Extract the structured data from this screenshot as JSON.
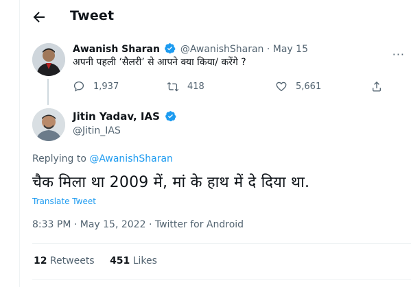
{
  "header": {
    "title": "Tweet"
  },
  "original_tweet": {
    "name": "Awanish Sharan",
    "handle": "@AwanishSharan",
    "separator": " · ",
    "date": "May 15",
    "text": "अपनी पहली ‘सैलरी’ से आपने क्या किया/ करेंगे ?",
    "replies": "1,937",
    "retweets": "418",
    "likes": "5,661",
    "more_label": "···"
  },
  "reply_tweet": {
    "name": "Jitin Yadav, IAS",
    "handle": "@Jitin_IAS",
    "replying_prefix": "Replying to ",
    "replying_to": "@AwanishSharan",
    "text": "चैक मिला था 2009 में, मां के हाथ में दे दिया था.",
    "translate_label": "Translate Tweet",
    "timestamp": "8:33 PM · May 15, 2022 · Twitter for Android",
    "retweet_count": "12",
    "retweet_label": " Retweets",
    "like_count": "451",
    "like_label": " Likes"
  },
  "colors": {
    "accent": "#1d9bf0",
    "text": "#0f1419",
    "muted": "#536471",
    "border": "#eff3f4"
  },
  "icons": [
    "back-arrow-icon",
    "verified-badge-icon",
    "reply-icon",
    "retweet-icon",
    "like-icon",
    "share-icon"
  ]
}
